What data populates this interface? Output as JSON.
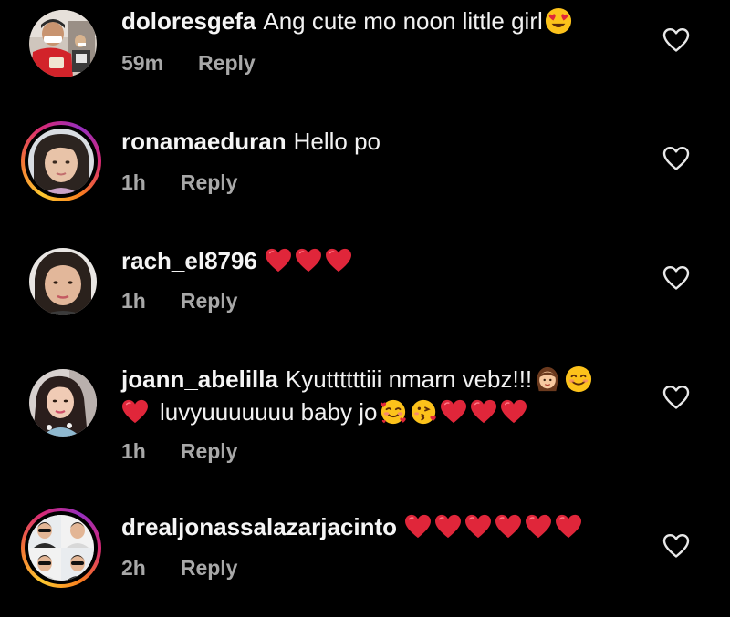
{
  "colors": {
    "background": "#000000",
    "text": "#f5f5f5",
    "meta": "#a8a8a8",
    "heart_emoji": "#e0263a",
    "story_ring": [
      "#fdc830",
      "#f37335",
      "#d62976",
      "#962fbf"
    ]
  },
  "comments": [
    {
      "username": "doloresgefa",
      "text": "Ang cute mo noon little girl",
      "emoji": [
        "heart-eyes-emoji"
      ],
      "time": "59m",
      "reply_label": "Reply",
      "avatar_story_ring": false,
      "like_icon": "heart-outline-icon"
    },
    {
      "username": "ronamaeduran",
      "text": "Hello po",
      "emoji": [],
      "time": "1h",
      "reply_label": "Reply",
      "avatar_story_ring": true,
      "like_icon": "heart-outline-icon"
    },
    {
      "username": "rach_el8796",
      "text": "",
      "emoji": [
        "red-heart-emoji",
        "red-heart-emoji",
        "red-heart-emoji"
      ],
      "time": "1h",
      "reply_label": "Reply",
      "avatar_story_ring": false,
      "like_icon": "heart-outline-icon"
    },
    {
      "username": "joann_abelilla",
      "text": "Kyuttttttiii nmarn vebz!!!",
      "text_line2": "luvyuuuuuuu baby jo",
      "emoji": [
        "girl-emoji",
        "smiling-face-emoji",
        "red-heart-emoji",
        "smiling-face-with-hearts-emoji",
        "kissing-face-emoji",
        "red-heart-emoji",
        "red-heart-emoji",
        "red-heart-emoji"
      ],
      "time": "1h",
      "reply_label": "Reply",
      "avatar_story_ring": false,
      "like_icon": "heart-outline-icon"
    },
    {
      "username": "drealjonassalazarjacinto",
      "text": "",
      "emoji": [
        "red-heart-emoji",
        "red-heart-emoji",
        "red-heart-emoji",
        "red-heart-emoji",
        "red-heart-emoji",
        "red-heart-emoji"
      ],
      "time": "2h",
      "reply_label": "Reply",
      "avatar_story_ring": true,
      "like_icon": "heart-outline-icon"
    }
  ]
}
